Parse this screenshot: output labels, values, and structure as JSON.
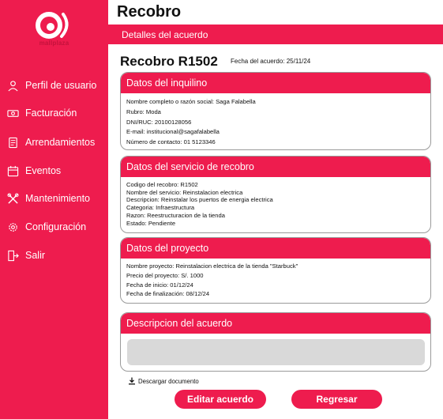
{
  "app": {
    "logo_text": "mallplaza"
  },
  "sidebar": {
    "items": [
      {
        "label": "Perfil de usuario",
        "icon": "user-icon"
      },
      {
        "label": "Facturación",
        "icon": "money-icon"
      },
      {
        "label": "Arrendamientos",
        "icon": "document-icon"
      },
      {
        "label": "Eventos",
        "icon": "calendar-icon"
      },
      {
        "label": "Mantenimiento",
        "icon": "tools-icon"
      },
      {
        "label": "Configuración",
        "icon": "gear-icon"
      },
      {
        "label": "Salir",
        "icon": "logout-icon"
      }
    ]
  },
  "header": {
    "title": "Recobro",
    "section": "Detalles del acuerdo"
  },
  "record": {
    "title": "Recobro R1502",
    "date": "Fecha del acuerdo: 25/11/24"
  },
  "cards": {
    "tenant": {
      "title": "Datos del inquilino",
      "lines": [
        "Nombre completo o razón social: Saga Falabella",
        "Rubro: Moda",
        "DNI/RUC: 20100128056",
        "E-mail: institucional@sagafalabella",
        "Número de contacto: 01 5123346"
      ]
    },
    "service": {
      "title": "Datos del servicio de recobro",
      "lines": [
        "Codigo del recobro: R1502",
        "Nombre del servicio: Reinstalacion electrica",
        "Descripcion: Reinstalar los puertos de energia electrica",
        "Categoria: Infraestructura",
        "Razon: Reestructuracion de la tienda",
        "Estado: Pendiente"
      ]
    },
    "project": {
      "title": "Datos del proyecto",
      "lines": [
        "Nombre proyecto: Reinstalacion electrica de la tienda \"Starbuck\"",
        "Precio del proyecto: S/. 1000",
        "Fecha de inicio: 01/12/24",
        "Fecha de finalización: 08/12/24"
      ]
    },
    "description": {
      "title": "Descripcion del acuerdo",
      "value": ""
    }
  },
  "actions": {
    "download_label": "Descargar documento",
    "edit_label": "Editar acuerdo",
    "back_label": "Regresar"
  },
  "colors": {
    "accent": "#ee1c4e",
    "panel": "#d9d9d9"
  }
}
